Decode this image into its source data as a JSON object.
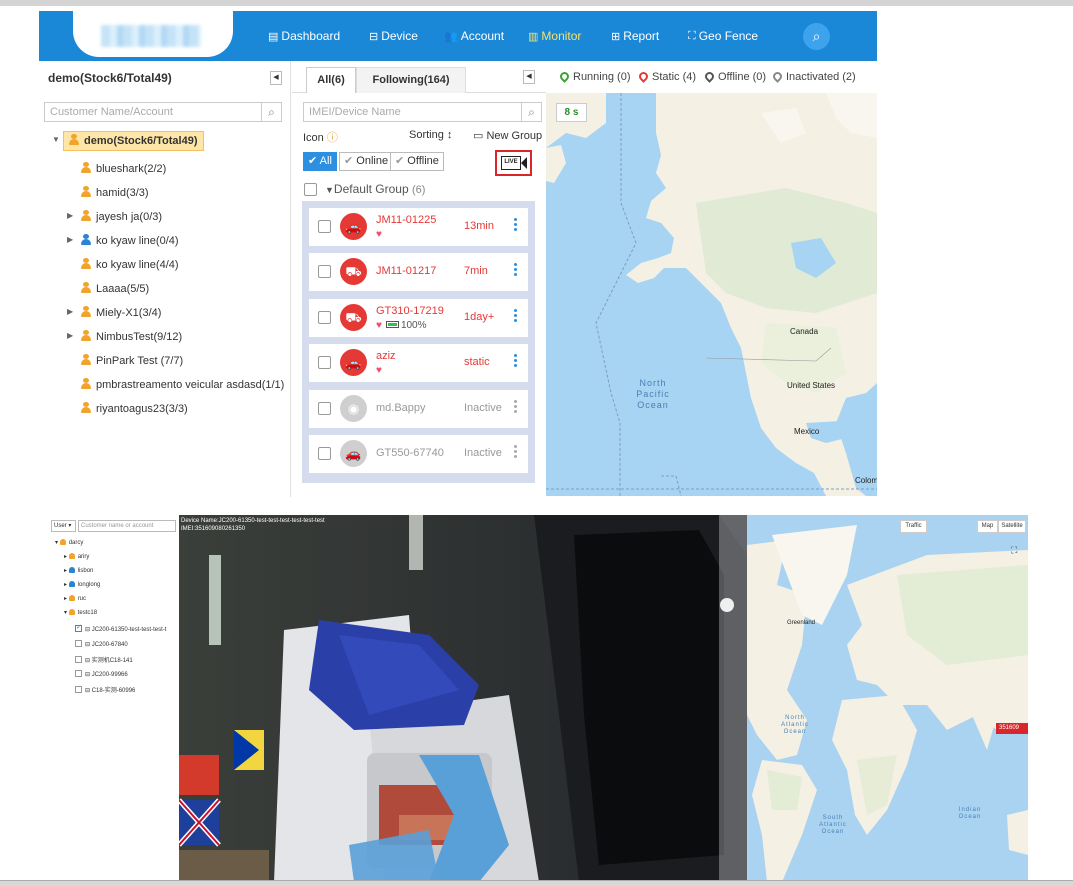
{
  "nav": {
    "items": [
      {
        "label": "Dashboard",
        "icon": "dashboard-icon"
      },
      {
        "label": "Device",
        "icon": "car-icon"
      },
      {
        "label": "Account",
        "icon": "users-icon"
      },
      {
        "label": "Monitor",
        "icon": "map-icon"
      },
      {
        "label": "Report",
        "icon": "table-icon"
      },
      {
        "label": "Geo Fence",
        "icon": "fence-icon"
      }
    ],
    "active": "Monitor",
    "accent_color": "#1a87d7",
    "active_color": "#f6e36e"
  },
  "left_panel": {
    "title": "demo(Stock6/Total49)",
    "search_placeholder": "Customer Name/Account",
    "tree": [
      {
        "label": "demo(Stock6/Total49)",
        "root": true
      },
      {
        "label": "blueshark(2/2)"
      },
      {
        "label": "hamid(3/3)"
      },
      {
        "label": "jayesh ja(0/3)",
        "expandable": true
      },
      {
        "label": "ko kyaw line(0/4)",
        "expandable": true,
        "blue": true
      },
      {
        "label": "ko kyaw line(4/4)"
      },
      {
        "label": "Laaaa(5/5)"
      },
      {
        "label": "Miely-X1(3/4)",
        "expandable": true
      },
      {
        "label": "NimbusTest(9/12)",
        "expandable": true
      },
      {
        "label": "PinPark Test (7/7)"
      },
      {
        "label": "pmbrastreamento veicular asdasd(1/1)"
      },
      {
        "label": "riyantoagus23(3/3)"
      }
    ]
  },
  "mid_panel": {
    "tab_all": "All(6)",
    "tab_following": "Following(164)",
    "search_placeholder": "IMEI/Device Name",
    "icon_label": "Icon",
    "sorting_label": "Sorting",
    "new_group_label": "New Group",
    "filters": {
      "all": "All",
      "online": "Online",
      "offline": "Offline"
    },
    "live_label": "LIVE",
    "group_label": "Default Group",
    "group_count": "(6)",
    "devices": [
      {
        "name": "JM11-01225",
        "status": "13min",
        "heart": true,
        "battery": "",
        "inactive": false
      },
      {
        "name": "JM11-01217",
        "status": "7min",
        "heart": false,
        "battery": "",
        "inactive": false
      },
      {
        "name": "GT310-17219",
        "status": "1day+",
        "heart": true,
        "battery": "100%",
        "inactive": false
      },
      {
        "name": "aziz",
        "status": "static",
        "heart": true,
        "battery": "",
        "inactive": false
      },
      {
        "name": "md.Bappy",
        "status": "Inactive",
        "heart": false,
        "battery": "",
        "inactive": true
      },
      {
        "name": "GT550-67740",
        "status": "Inactive",
        "heart": false,
        "battery": "",
        "inactive": true
      }
    ]
  },
  "map_panel": {
    "legend": [
      {
        "label": "Running (0)",
        "color": "#3aa335"
      },
      {
        "label": "Static (4)",
        "color": "#e53935"
      },
      {
        "label": "Offline (0)",
        "color": "#555555"
      },
      {
        "label": "Inactivated (2)",
        "color": "#888888"
      }
    ],
    "timer": "8 s",
    "labels": {
      "canada": "Canada",
      "us": "United States",
      "mexico": "Mexico",
      "colombia": "Colom",
      "ocean": "North Pacific Ocean"
    }
  },
  "bottom": {
    "select_label": "User",
    "search_placeholder": "Customer name or account",
    "tree": [
      {
        "label": "darcy",
        "indent": 0,
        "type": "root"
      },
      {
        "label": "ariry",
        "indent": 1,
        "type": "user"
      },
      {
        "label": "lisbon",
        "indent": 1,
        "type": "user-blue"
      },
      {
        "label": "longlong",
        "indent": 1,
        "type": "user-blue"
      },
      {
        "label": "ruc",
        "indent": 1,
        "type": "user"
      },
      {
        "label": "testc18",
        "indent": 1,
        "type": "user-open"
      },
      {
        "label": "JC200-61350-test-test-test-t",
        "indent": 2,
        "type": "device-checked"
      },
      {
        "label": "JC200-67840",
        "indent": 2,
        "type": "device"
      },
      {
        "label": "实测机C18-141",
        "indent": 2,
        "type": "device"
      },
      {
        "label": "JC200-99966",
        "indent": 2,
        "type": "device"
      },
      {
        "label": "C18-实测-60996",
        "indent": 2,
        "type": "device"
      }
    ],
    "video_device_name": "Device Name:JC200-61350-test-test-test-test-test-test",
    "video_imei": "IMEI:351609080261350",
    "map_traffic": "Traffic",
    "map_map": "Map",
    "map_satellite": "Satellite",
    "marker_label": "351609",
    "map_labels": {
      "greenland": "Greenland",
      "north_atlantic": "North Atlantic Ocean",
      "south_atlantic": "South Atlantic Ocean",
      "indian": "Indian Ocean"
    }
  }
}
